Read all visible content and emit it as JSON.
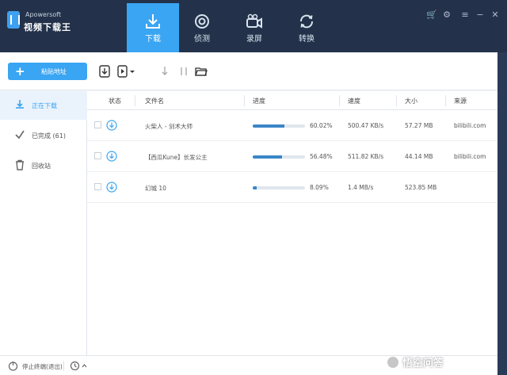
{
  "app": {
    "brand_small": "Apowersoft",
    "brand_name": "视频下载王"
  },
  "tabs": [
    {
      "label": "下载",
      "icon": "download-tray-icon",
      "active": true
    },
    {
      "label": "侦测",
      "icon": "target-icon",
      "active": false
    },
    {
      "label": "录屏",
      "icon": "video-camera-icon",
      "active": false
    },
    {
      "label": "转换",
      "icon": "convert-icon",
      "active": false
    }
  ],
  "toolbar": {
    "paste_label": "粘贴地址"
  },
  "sidebar": {
    "items": [
      {
        "label": "正在下载",
        "icon": "download-icon",
        "active": true
      },
      {
        "label": "已完成 (61)",
        "icon": "check-icon",
        "active": false
      },
      {
        "label": "回收站",
        "icon": "trash-icon",
        "active": false
      }
    ]
  },
  "table": {
    "columns": [
      "状态",
      "文件名",
      "进度",
      "速度",
      "大小",
      "来源"
    ],
    "rows": [
      {
        "name": "火柴人 - 剑术大师",
        "progress_text": "60.02%",
        "progress": 60.02,
        "speed": "500.47 KB/s",
        "size": "57.27 MB",
        "source": "bilibili.com"
      },
      {
        "name": "【西瓜Kune】长发公主",
        "progress_text": "56.48%",
        "progress": 56.48,
        "speed": "511.82 KB/s",
        "size": "44.14 MB",
        "source": "bilibili.com"
      },
      {
        "name": "幻城 10",
        "progress_text": "8.09%",
        "progress": 8.09,
        "speed": "1.4 MB/s",
        "size": "523.85 MB",
        "source": ""
      }
    ]
  },
  "statusbar": {
    "stop_label": "停止终端(退出)"
  },
  "watermark": {
    "text": "悟空问答"
  },
  "colors": {
    "accent": "#3aa5f2",
    "titlebar": "#23324a",
    "progress": "#3a86c8"
  }
}
